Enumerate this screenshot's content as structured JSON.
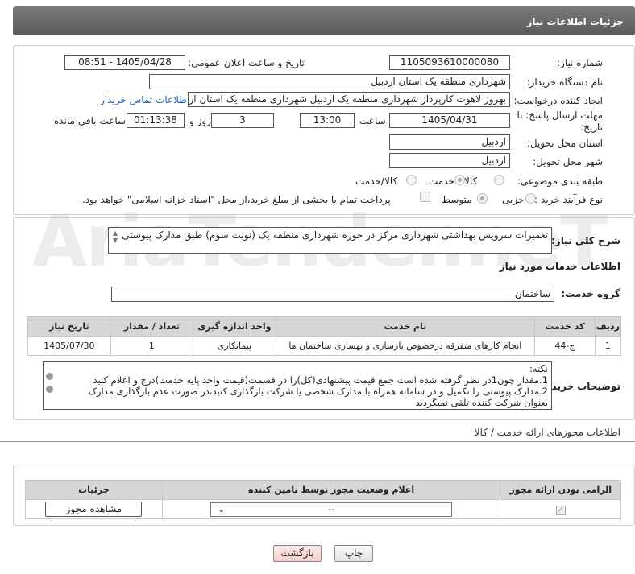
{
  "header": {
    "title": "جزئیات اطلاعات نیاز"
  },
  "form": {
    "need_number_label": "شماره نیاز:",
    "need_number": "1105093610000080",
    "announce_label": "تاریخ و ساعت اعلان عمومی:",
    "announce_value": "1405/04/28 - 08:51",
    "buyer_org_label": "نام دستگاه خریدار:",
    "buyer_org": "شهرداری منطقه یک استان اردبیل",
    "creator_label": "ایجاد کننده درخواست:",
    "creator": "بهروز لاهوت کارپرداز شهرداری منطقه یک اردبیل شهرداری منطقه یک استان اردبیل",
    "contact_link": "اطلاعات تماس خریدار",
    "deadline_label_1": "مهلت ارسال پاسخ: تا",
    "deadline_label_2": "تاریخ:",
    "deadline_date": "1405/04/31",
    "time_label": "ساعت",
    "deadline_time": "13:00",
    "days_value": "3",
    "days_label": "روز و",
    "remaining_time": "01:13:38",
    "remaining_label": "ساعت باقی مانده",
    "province_label": "استان محل تحویل:",
    "province": "اردبیل",
    "city_label": "شهر محل تحویل:",
    "city": "اردبیل",
    "category_label": "طبقه بندی موضوعی:",
    "category_options": [
      "کالا",
      "خدمت",
      "کالا/خدمت"
    ],
    "category_selected": "خدمت",
    "purchase_type_label": "نوع فرآیند خرید :",
    "purchase_options": [
      "جزیی",
      "متوسط"
    ],
    "purchase_selected": "متوسط",
    "treasury_note": "پرداخت تمام یا بخشی از مبلغ خرید،از محل \"اسناد خزانه اسلامی\" خواهد بود."
  },
  "description": {
    "label": "شرح کلی نیاز:",
    "text": "تعمیرات سرویس بهداشتی شهرداری مرکز در حوزه شهرداری منطقه یک (نوبت سوم) طبق مدارک پیوستی"
  },
  "services": {
    "section_title": "اطلاعات خدمات مورد نیاز",
    "group_label": "گروه خدمت:",
    "group_value": "ساختمان",
    "columns": [
      "ردیف",
      "کد خدمت",
      "نام خدمت",
      "واحد اندازه گیری",
      "تعداد / مقدار",
      "تاریخ نیاز"
    ],
    "rows": [
      [
        "1",
        "ج-44",
        "انجام کارهای متفرقه درخصوص بازسازی و بهسازی ساختمان ها",
        "پیمانکاری",
        "1",
        "1405/07/30"
      ]
    ]
  },
  "buyer_notes": {
    "label": "توضیحات خریدار:",
    "lines": [
      "نکته:",
      "1.مقدار چون1در نظر گرفته شده است جمع قیمت پیشنهادی(کل)را در قسمت(قیمت واحد پایه خدمت)درج و اعلام کنید",
      "2.مدارک پیوستی را تکمیل و در سامانه همراه با مدارک شخصی یا شرکت بارگذاری کنید،در صورت عدم بارگذاری مدارک",
      "بعنوان شرکت کننده تلقی نمیگردید"
    ]
  },
  "permits": {
    "section_title": "اطلاعات مجوزهای ارائه خدمت / کالا",
    "columns": [
      "الزامی بودن ارائه مجوز",
      "اعلام وضعیت مجوز توسط تامین کننده",
      "جزئیات"
    ],
    "select_value": "--",
    "view_button": "مشاهده مجوز"
  },
  "footer": {
    "print_button": "چاپ",
    "back_button": "بازگشت"
  },
  "watermark": "AriaTender.neT"
}
